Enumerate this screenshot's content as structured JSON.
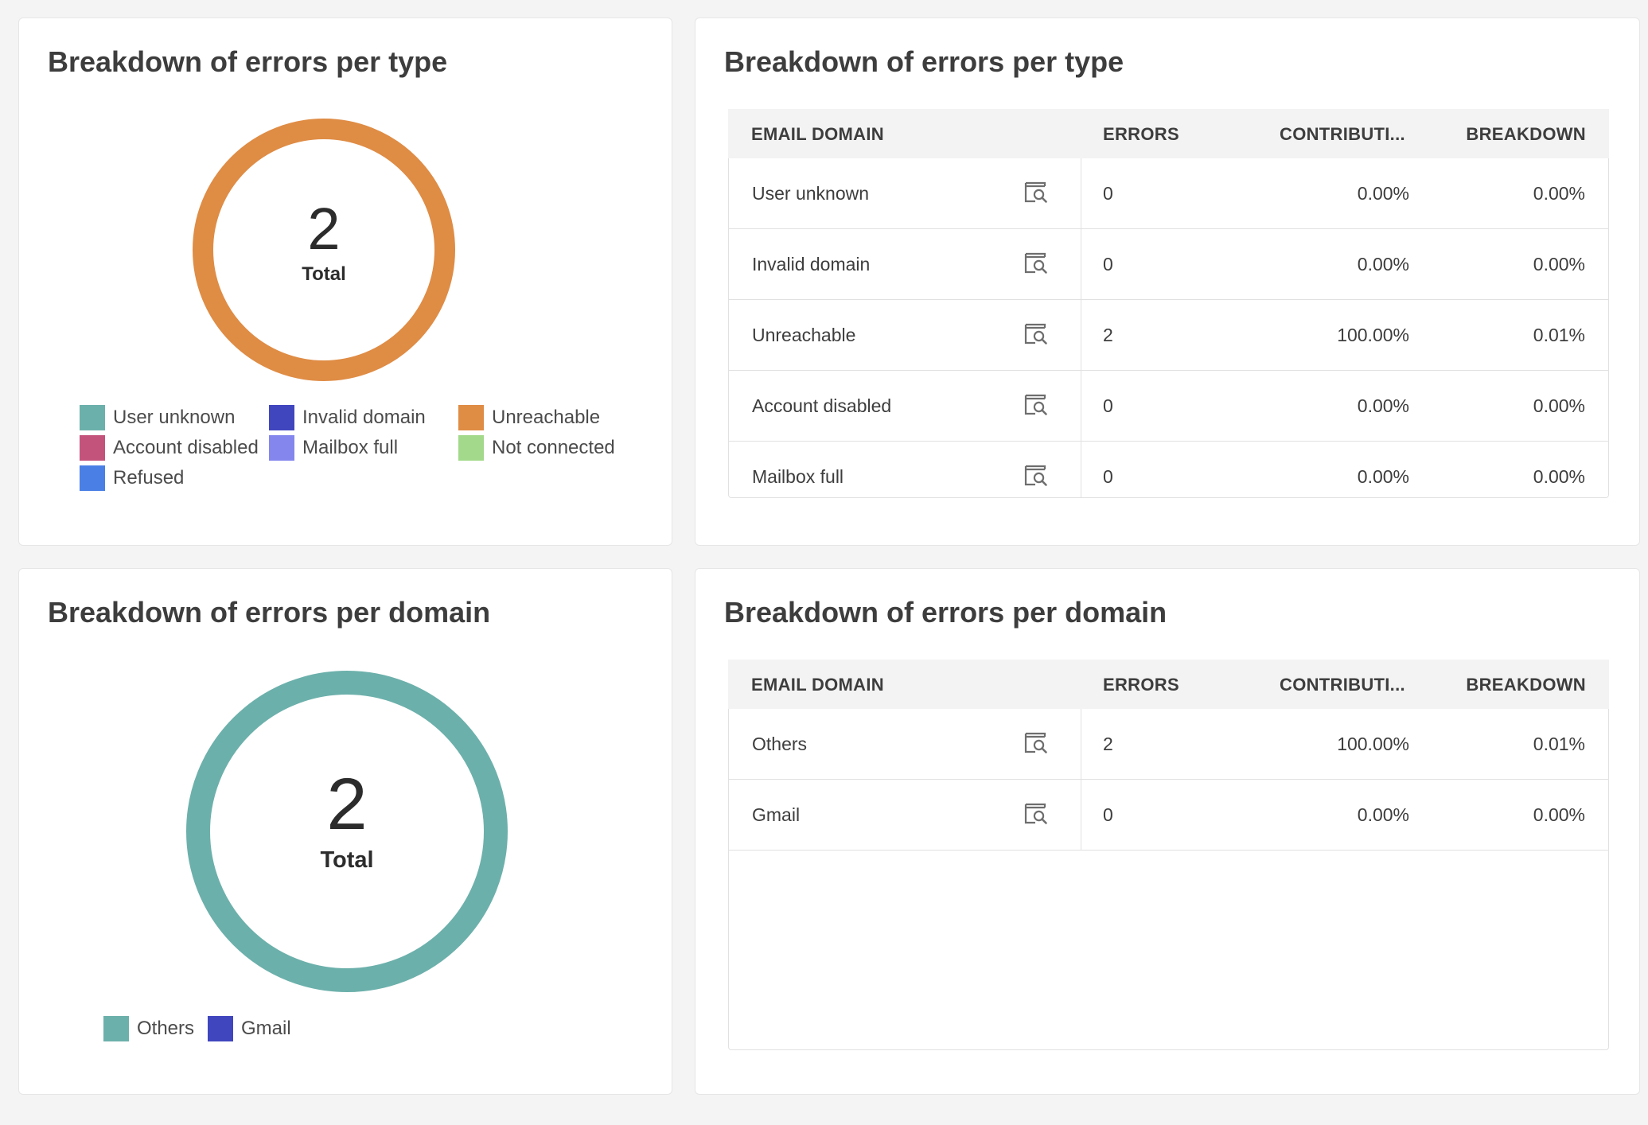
{
  "colors": {
    "user_unknown": "#6cb0ab",
    "invalid_domain": "#4046be",
    "unreachable": "#df8c45",
    "account_disabled": "#c4537c",
    "mailbox_full": "#8486ee",
    "not_connected": "#a2d98a",
    "refused": "#4a7fe6",
    "others": "#6cb0ab",
    "gmail": "#4046be"
  },
  "type_donut": {
    "title": "Breakdown of errors per type",
    "total": "2",
    "total_label": "Total",
    "legend": [
      {
        "label": "User unknown",
        "color_key": "user_unknown"
      },
      {
        "label": "Invalid domain",
        "color_key": "invalid_domain"
      },
      {
        "label": "Unreachable",
        "color_key": "unreachable"
      },
      {
        "label": "Account disabled",
        "color_key": "account_disabled"
      },
      {
        "label": "Mailbox full",
        "color_key": "mailbox_full"
      },
      {
        "label": "Not connected",
        "color_key": "not_connected"
      },
      {
        "label": "Refused",
        "color_key": "refused"
      }
    ]
  },
  "type_table": {
    "title": "Breakdown of errors per type",
    "headers": {
      "name": "EMAIL DOMAIN",
      "errors": "ERRORS",
      "contribution": "CONTRIBUTI...",
      "breakdown": "BREAKDOWN"
    },
    "rows": [
      {
        "name": "User unknown",
        "errors": "0",
        "contribution": "0.00%",
        "breakdown": "0.00%"
      },
      {
        "name": "Invalid domain",
        "errors": "0",
        "contribution": "0.00%",
        "breakdown": "0.00%"
      },
      {
        "name": "Unreachable",
        "errors": "2",
        "contribution": "100.00%",
        "breakdown": "0.01%"
      },
      {
        "name": "Account disabled",
        "errors": "0",
        "contribution": "0.00%",
        "breakdown": "0.00%"
      },
      {
        "name": "Mailbox full",
        "errors": "0",
        "contribution": "0.00%",
        "breakdown": "0.00%"
      }
    ]
  },
  "domain_donut": {
    "title": "Breakdown of errors per domain",
    "total": "2",
    "total_label": "Total",
    "legend": [
      {
        "label": "Others",
        "color_key": "others"
      },
      {
        "label": "Gmail",
        "color_key": "gmail"
      }
    ]
  },
  "domain_table": {
    "title": "Breakdown of errors per domain",
    "headers": {
      "name": "EMAIL DOMAIN",
      "errors": "ERRORS",
      "contribution": "CONTRIBUTI...",
      "breakdown": "BREAKDOWN"
    },
    "rows": [
      {
        "name": "Others",
        "errors": "2",
        "contribution": "100.00%",
        "breakdown": "0.01%"
      },
      {
        "name": "Gmail",
        "errors": "0",
        "contribution": "0.00%",
        "breakdown": "0.00%"
      }
    ]
  },
  "chart_data": [
    {
      "type": "pie",
      "title": "Breakdown of errors per type",
      "categories": [
        "User unknown",
        "Invalid domain",
        "Unreachable",
        "Account disabled",
        "Mailbox full",
        "Not connected",
        "Refused"
      ],
      "values": [
        0,
        0,
        2,
        0,
        0,
        0,
        0
      ],
      "center_text": "2 Total",
      "legend": "bottom"
    },
    {
      "type": "pie",
      "title": "Breakdown of errors per domain",
      "categories": [
        "Others",
        "Gmail"
      ],
      "values": [
        2,
        0
      ],
      "center_text": "2 Total",
      "legend": "bottom"
    }
  ]
}
